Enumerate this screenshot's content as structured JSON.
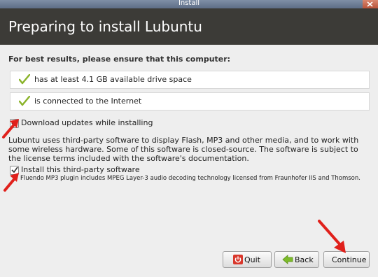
{
  "window": {
    "title": "Install"
  },
  "header": {
    "title": "Preparing to install Lubuntu"
  },
  "lead": "For best results, please ensure that this computer:",
  "requirements": [
    {
      "label": "has at least 4.1 GB available drive space",
      "met": true
    },
    {
      "label": "is connected to the Internet",
      "met": true
    }
  ],
  "options": {
    "download_updates": {
      "label": "Download updates while installing",
      "checked": true
    },
    "third_party_info": "Lubuntu uses third-party software to display Flash, MP3 and other media, and to work with some wireless hardware. Some of this software is closed-source. The software is subject to the license terms included with the software's documentation.",
    "install_third_party": {
      "label": "Install this third-party software",
      "checked": true
    },
    "third_party_note": "Fluendo MP3 plugin includes MPEG Layer-3 audio decoding technology licensed from Fraunhofer IIS and Thomson."
  },
  "buttons": {
    "quit": "Quit",
    "back": "Back",
    "continue": "Continue"
  },
  "colors": {
    "header_bg": "#3c3b37",
    "check_green": "#8ab32a",
    "annotation_red": "#e0201b"
  }
}
